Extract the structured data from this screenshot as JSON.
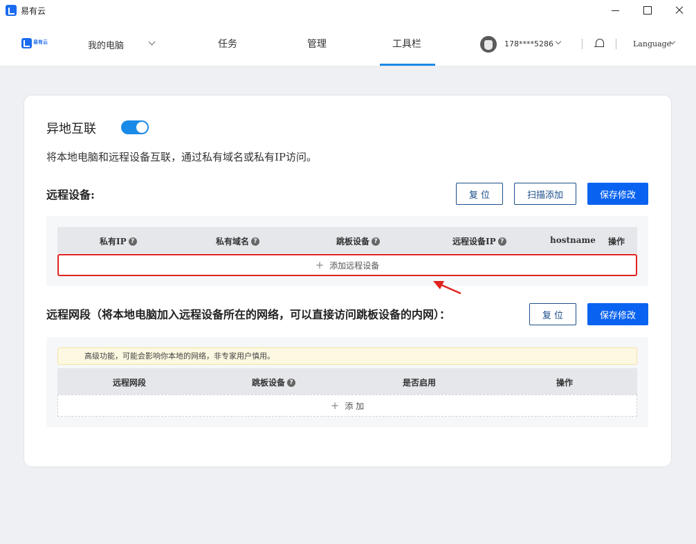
{
  "window": {
    "title": "易有云"
  },
  "nav": {
    "logo_text": "易有云",
    "pc_label": "我的电脑",
    "tasks": "任务",
    "manage": "管理",
    "toolbar": "工具栏",
    "user_phone": "178****5286",
    "language": "Language"
  },
  "feature": {
    "title": "异地互联",
    "enabled": true,
    "description": "将本地电脑和远程设备互联，通过私有域名或私有IP访问。"
  },
  "remote_devices": {
    "title": "远程设备:",
    "buttons": {
      "reset": "复 位",
      "scan_add": "扫描添加",
      "save": "保存修改"
    },
    "columns": [
      "私有IP",
      "私有域名",
      "跳板设备",
      "远程设备IP",
      "hostname",
      "操作"
    ],
    "add_label": "添加远程设备"
  },
  "remote_segments": {
    "title": "远程网段（将本地电脑加入远程设备所在的网络，可以直接访问跳板设备的内网）：",
    "buttons": {
      "reset": "复 位",
      "save": "保存修改"
    },
    "warning": "高级功能，可能会影响你本地的网络，非专家用户慎用。",
    "columns": [
      "远程网段",
      "跳板设备",
      "是否启用",
      "操作"
    ],
    "add_label": "添 加"
  },
  "colors": {
    "accent": "#1a8ae8",
    "primary_button": "#0a63f0",
    "highlight": "#e0231e"
  }
}
